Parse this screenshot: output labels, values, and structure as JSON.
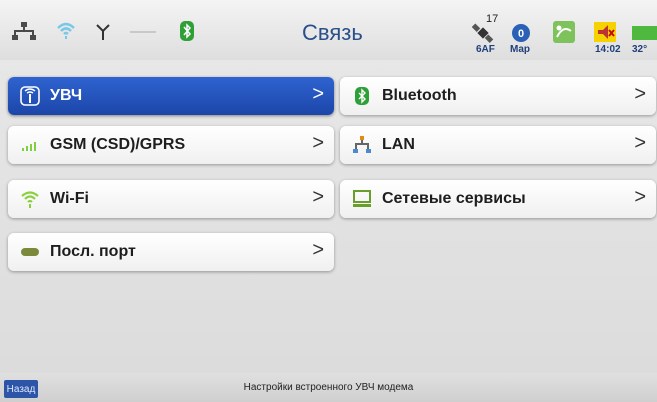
{
  "header": {
    "title": "Связь",
    "sat_count": "17",
    "sat_label": "6AF",
    "map_label": "Map",
    "time": "14:02",
    "temp": "32°"
  },
  "menu": {
    "uhf": "УВЧ",
    "gsm": "GSM (CSD)/GPRS",
    "wifi": "Wi-Fi",
    "serial": "Посл. порт",
    "bluetooth": "Bluetooth",
    "lan": "LAN",
    "services": "Сетевые сервисы",
    "chevron": ">"
  },
  "footer": {
    "back_label": "Назад",
    "status_text": "Настройки встроенного УВЧ модема"
  },
  "colors": {
    "active_tile": "#2f63d0",
    "title": "#2a4f8a",
    "back_button": "#2c55a8"
  }
}
